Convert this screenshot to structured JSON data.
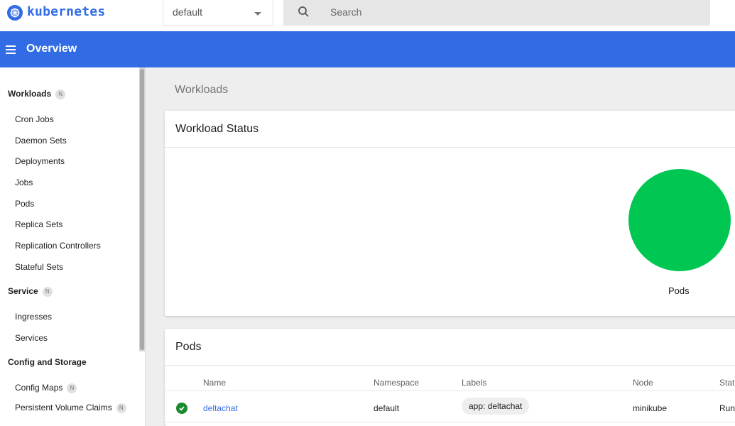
{
  "app": {
    "brand": "kubernetes"
  },
  "namespace": {
    "selected": "default"
  },
  "search": {
    "placeholder": "Search"
  },
  "header": {
    "title": "Overview"
  },
  "sidebar": {
    "sections": [
      {
        "label": "Workloads",
        "badge": "N",
        "items": [
          "Cron Jobs",
          "Daemon Sets",
          "Deployments",
          "Jobs",
          "Pods",
          "Replica Sets",
          "Replication Controllers",
          "Stateful Sets"
        ]
      },
      {
        "label": "Service",
        "badge": "N",
        "items": [
          "Ingresses",
          "Services"
        ]
      },
      {
        "label": "Config and Storage",
        "items": [
          {
            "label": "Config Maps",
            "badge": "N"
          },
          {
            "label": "Persistent Volume Claims",
            "badge": "N"
          }
        ]
      }
    ]
  },
  "main": {
    "section_title": "Workloads",
    "workload_status": {
      "title": "Workload Status",
      "chart_label": "Pods"
    },
    "pods": {
      "title": "Pods",
      "columns": [
        "Name",
        "Namespace",
        "Labels",
        "Node",
        "Stat"
      ],
      "rows": [
        {
          "status": "running",
          "name": "deltachat",
          "namespace": "default",
          "labels": "app: deltachat",
          "node": "minikube",
          "state": "Run"
        }
      ]
    }
  },
  "colors": {
    "accent": "#326ce5",
    "running": "#00c752",
    "success_icon": "#1b8a2e"
  }
}
